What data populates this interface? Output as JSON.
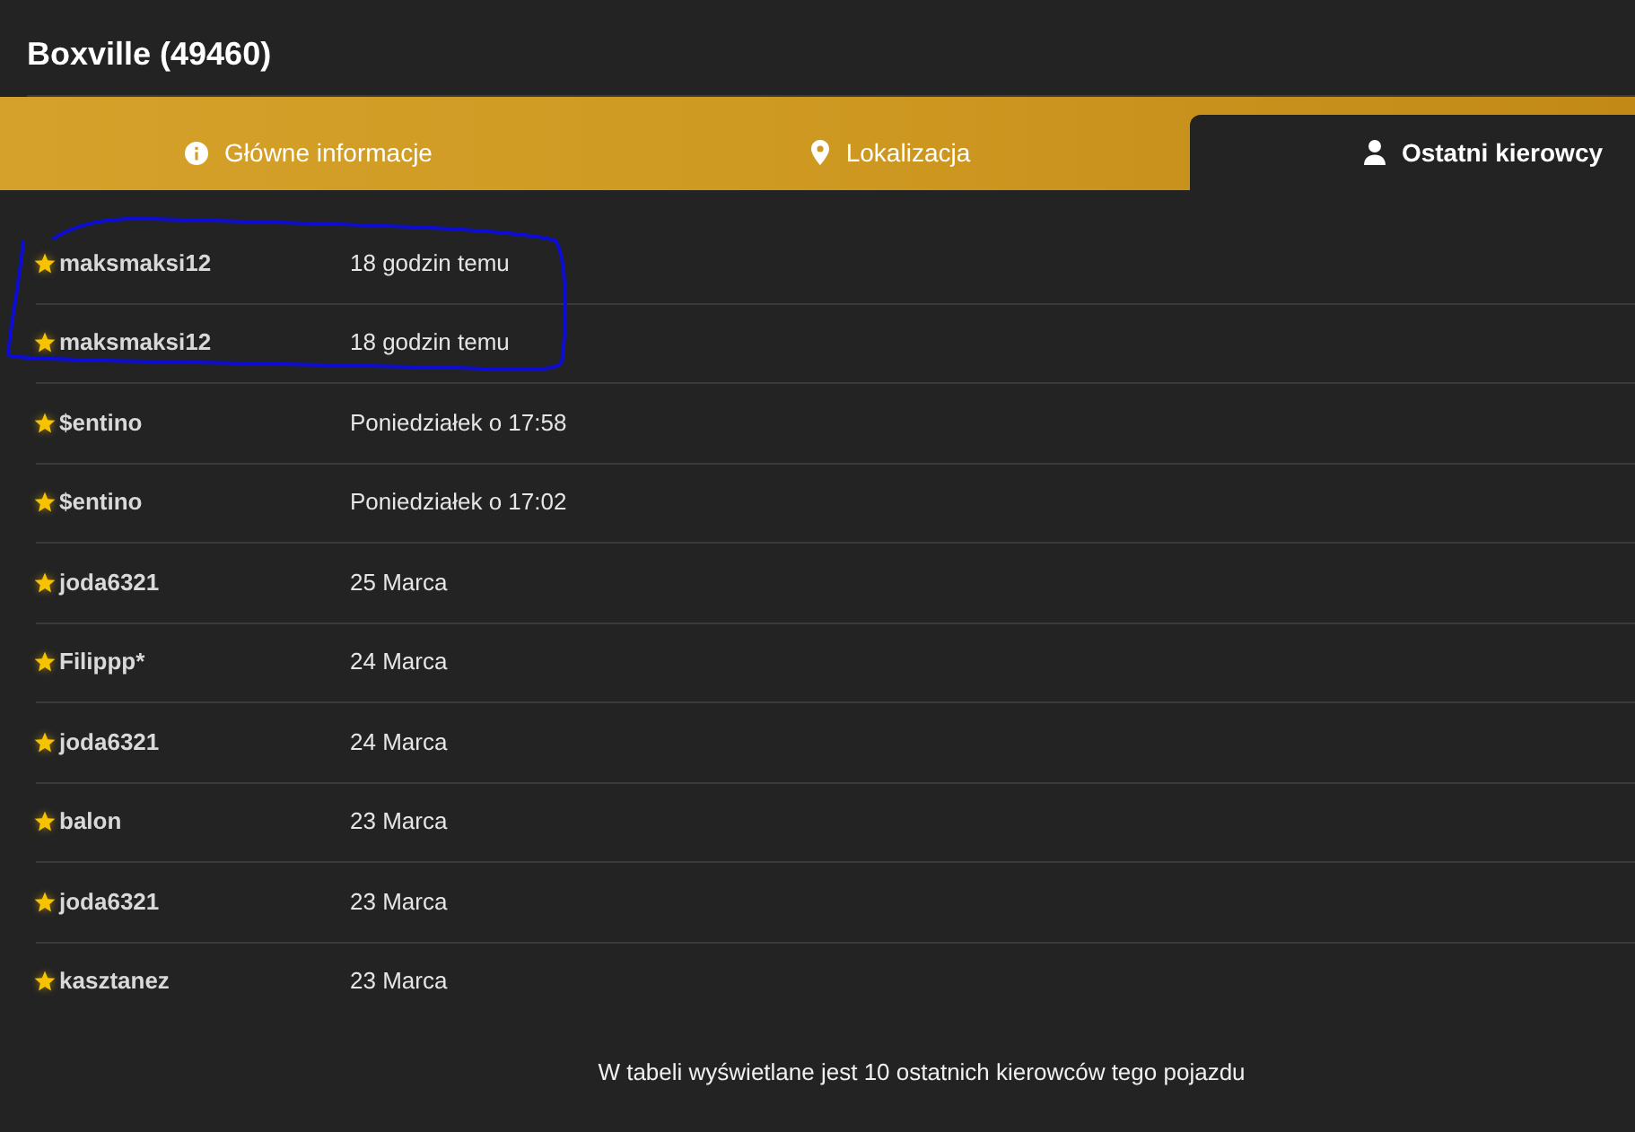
{
  "title": "Boxville (49460)",
  "tabs": [
    {
      "label": "Główne informacje",
      "selected": false
    },
    {
      "label": "Lokalizacja",
      "selected": false
    },
    {
      "label": "Ostatni kierowcy",
      "selected": true
    }
  ],
  "rows": [
    {
      "driver": "maksmaksi12",
      "time": "18 godzin temu",
      "starred": true,
      "circled": true
    },
    {
      "driver": "maksmaksi12",
      "time": "18 godzin temu",
      "starred": true,
      "circled": true
    },
    {
      "driver": "$entino",
      "time": "Poniedziałek o 17:58",
      "starred": true,
      "circled": false
    },
    {
      "driver": "$entino",
      "time": "Poniedziałek o 17:02",
      "starred": true,
      "circled": false
    },
    {
      "driver": "joda6321",
      "time": "25 Marca",
      "starred": true,
      "circled": false
    },
    {
      "driver": "Filippp*",
      "time": "24 Marca",
      "starred": true,
      "circled": false
    },
    {
      "driver": "joda6321",
      "time": "24 Marca",
      "starred": true,
      "circled": false
    },
    {
      "driver": "balon",
      "time": "23 Marca",
      "starred": true,
      "circled": false
    },
    {
      "driver": "joda6321",
      "time": "23 Marca",
      "starred": true,
      "circled": false
    },
    {
      "driver": "kasztanez",
      "time": "23 Marca",
      "starred": true,
      "circled": false
    }
  ],
  "note": "W tabeli wyświetlane jest 10 ostatnich kierowców tego pojazdu"
}
